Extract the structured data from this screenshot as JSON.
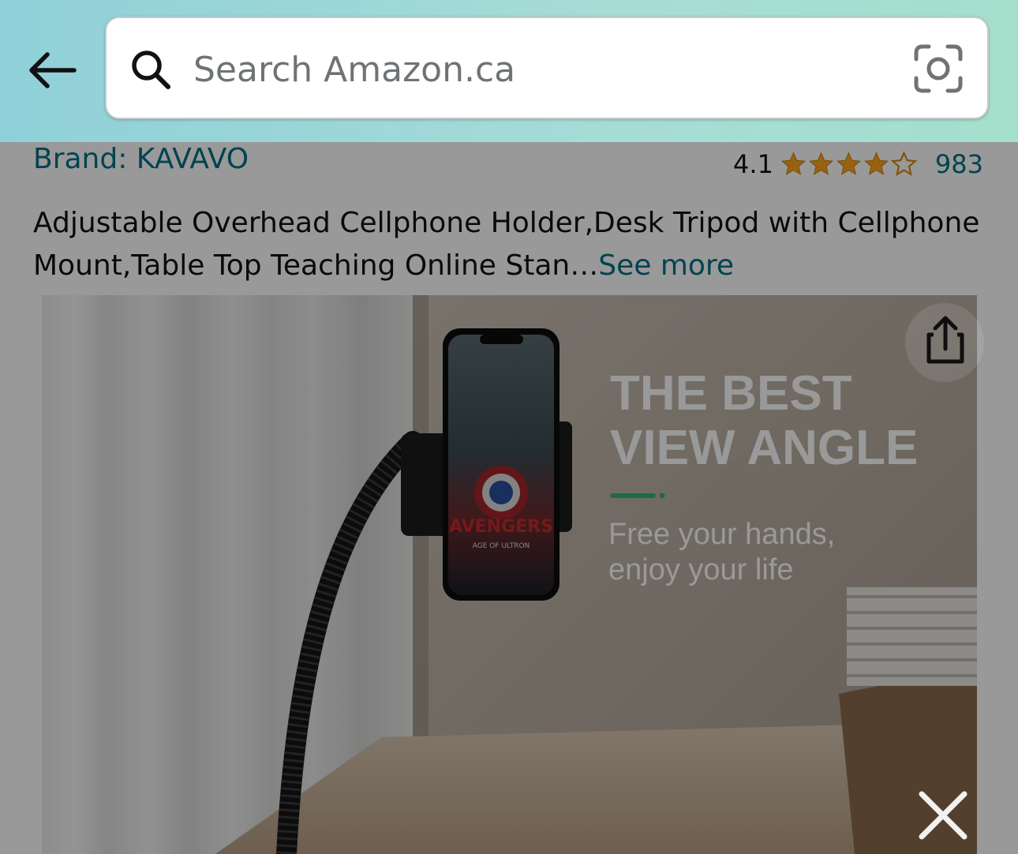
{
  "header": {
    "back_icon": "arrow-left-icon",
    "search_placeholder": "Search Amazon.ca",
    "search_icon": "search-icon",
    "camera_icon": "camera-lens-icon"
  },
  "product": {
    "brand": "Brand: KAVAVO",
    "rating": "4.1",
    "rating_value": 4.1,
    "rating_max": 5,
    "review_count": "983",
    "title": "Adjustable Overhead Cellphone Holder,Desk Tripod with Cellphone Mount,Table Top Teaching Online Stan…",
    "see_more_label": "See more"
  },
  "image_panel": {
    "headline_1": "THE BEST",
    "headline_2": "VIEW ANGLE",
    "sub_1": "Free your hands,",
    "sub_2": "enjoy your life",
    "phone_title": "AVENGERS",
    "phone_subtitle": "AGE OF ULTRON",
    "share_icon": "share-icon",
    "close_icon": "close-icon"
  },
  "colors": {
    "link": "#007185",
    "star": "#ffa41c",
    "accent_green": "#2fb37a"
  }
}
